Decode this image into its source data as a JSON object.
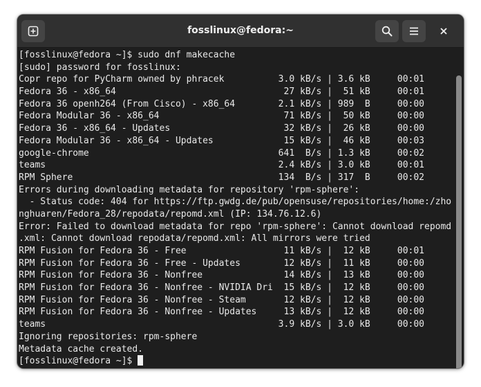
{
  "window": {
    "title": "fosslinux@fedora:~"
  },
  "icons": {
    "new_tab": "new-tab-icon",
    "search": "search-icon",
    "menu": "hamburger-menu-icon",
    "close": "close-icon"
  },
  "colors": {
    "background": "#1e1e1e",
    "headerbar": "#303030",
    "text": "#e9e9e9"
  },
  "terminal": {
    "lines": [
      "[fosslinux@fedora ~]$ sudo dnf makecache",
      "[sudo] password for fosslinux:",
      "Copr repo for PyCharm owned by phracek          3.0 kB/s | 3.6 kB     00:01",
      "Fedora 36 - x86_64                               27 kB/s |  51 kB     00:01",
      "Fedora 36 openh264 (From Cisco) - x86_64        2.1 kB/s | 989  B     00:00",
      "Fedora Modular 36 - x86_64                       71 kB/s |  50 kB     00:00",
      "Fedora 36 - x86_64 - Updates                     32 kB/s |  26 kB     00:00",
      "Fedora Modular 36 - x86_64 - Updates             15 kB/s |  46 kB     00:03",
      "google-chrome                                   641  B/s | 1.3 kB     00:02",
      "teams                                           2.4 kB/s | 3.0 kB     00:01",
      "RPM Sphere                                      134  B/s | 317  B     00:02",
      "Errors during downloading metadata for repository 'rpm-sphere':",
      "  - Status code: 404 for https://ftp.gwdg.de/pub/opensuse/repositories/home:/zho",
      "nghuaren/Fedora_28/repodata/repomd.xml (IP: 134.76.12.6)",
      "Error: Failed to download metadata for repo 'rpm-sphere': Cannot download repomd",
      ".xml: Cannot download repodata/repomd.xml: All mirrors were tried",
      "RPM Fusion for Fedora 36 - Free                  11 kB/s |  12 kB     00:01",
      "RPM Fusion for Fedora 36 - Free - Updates        12 kB/s |  11 kB     00:00",
      "RPM Fusion for Fedora 36 - Nonfree               14 kB/s |  13 kB     00:00",
      "RPM Fusion for Fedora 36 - Nonfree - NVIDIA Dri  15 kB/s |  12 kB     00:00",
      "RPM Fusion for Fedora 36 - Nonfree - Steam       12 kB/s |  12 kB     00:00",
      "RPM Fusion for Fedora 36 - Nonfree - Updates     13 kB/s |  12 kB     00:00",
      "teams                                           3.9 kB/s | 3.0 kB     00:00",
      "Ignoring repositories: rpm-sphere",
      "Metadata cache created."
    ],
    "prompt": "[fosslinux@fedora ~]$ "
  }
}
